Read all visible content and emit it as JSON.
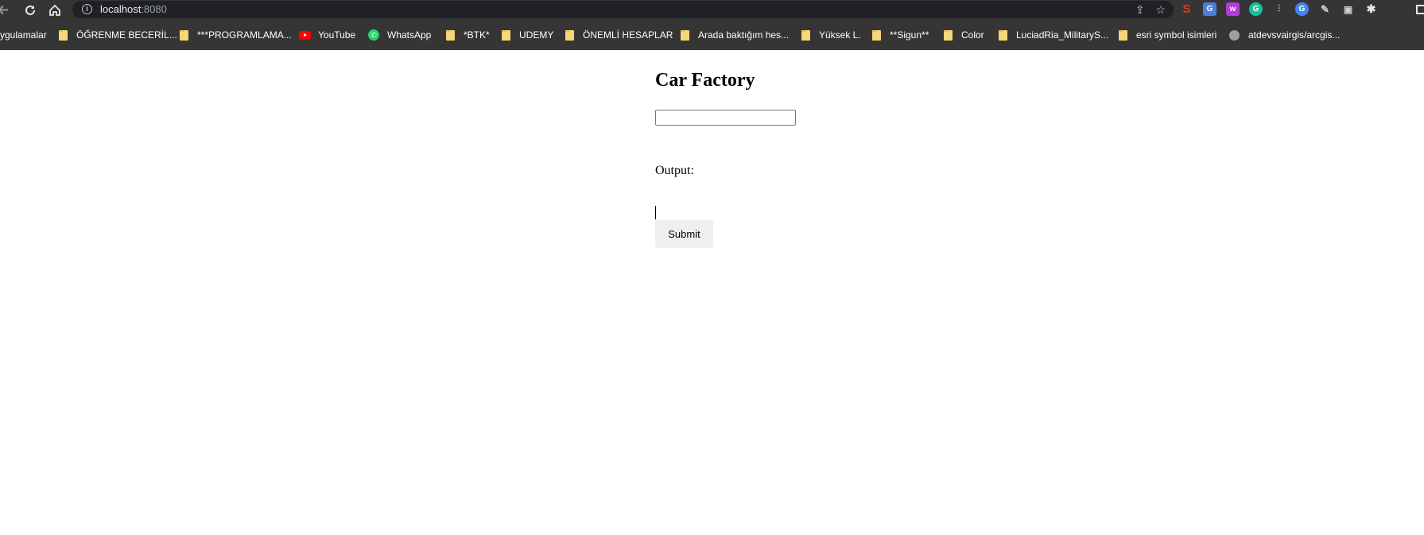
{
  "browser": {
    "url_host": "localhost",
    "url_port": ":8080",
    "bookmarks": [
      {
        "label": "ygulamalar"
      },
      {
        "label": "ÖĞRENME BECERİL..."
      },
      {
        "label": "***PROGRAMLAMA..."
      },
      {
        "label": "YouTube"
      },
      {
        "label": "WhatsApp"
      },
      {
        "label": "*BTK*"
      },
      {
        "label": "UDEMY"
      },
      {
        "label": "ÖNEMLİ HESAPLAR"
      },
      {
        "label": "Arada baktığım hes..."
      },
      {
        "label": "Yüksek L."
      },
      {
        "label": "**Sigun**"
      },
      {
        "label": "Color"
      },
      {
        "label": "LuciadRia_MilitaryS..."
      },
      {
        "label": "esri symbol isimleri"
      },
      {
        "label": "atdevsvairgis/arcgis..."
      }
    ],
    "icons": {
      "back": "arrow-left-icon",
      "reload": "reload-icon",
      "home": "home-icon",
      "site_info": "info-icon",
      "share": "share-icon",
      "bookmark_star": "star-icon",
      "extensions": "puzzle-icon",
      "side_panel": "side-panel-icon"
    }
  },
  "page": {
    "title": "Car Factory",
    "input_value": "",
    "output_label": "Output:",
    "submit_label": "Submit"
  }
}
